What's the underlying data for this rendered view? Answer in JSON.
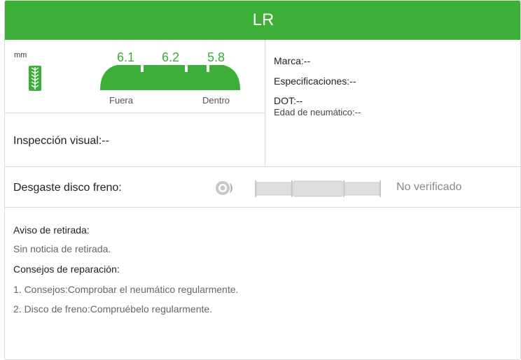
{
  "header": {
    "title": "LR"
  },
  "tread": {
    "unit": "mm",
    "depths": [
      "6.1",
      "6.2",
      "5.8"
    ],
    "outer_label": "Fuera",
    "inner_label": "Dentro",
    "accent_color": "#3dae37",
    "icon": "tire-tread-icon"
  },
  "visual_inspection": {
    "label": "Inspección visual:--"
  },
  "tire_info": {
    "brand": "Marca:--",
    "specs": "Especificaciones:--",
    "dot": "DOT:--",
    "age": "Edad de neumático:--"
  },
  "brake": {
    "label": "Desgaste disco freno:",
    "icon": "brake-disc-icon",
    "status": "No verificado"
  },
  "recall": {
    "title": "Aviso de retirada:",
    "text": "Sin noticia de retirada."
  },
  "repair": {
    "title": "Consejos de reparación:",
    "items": [
      "1. Consejos:Comprobar el neumático regularmente.",
      "2. Disco de freno:Compruébelo regularmente."
    ]
  }
}
